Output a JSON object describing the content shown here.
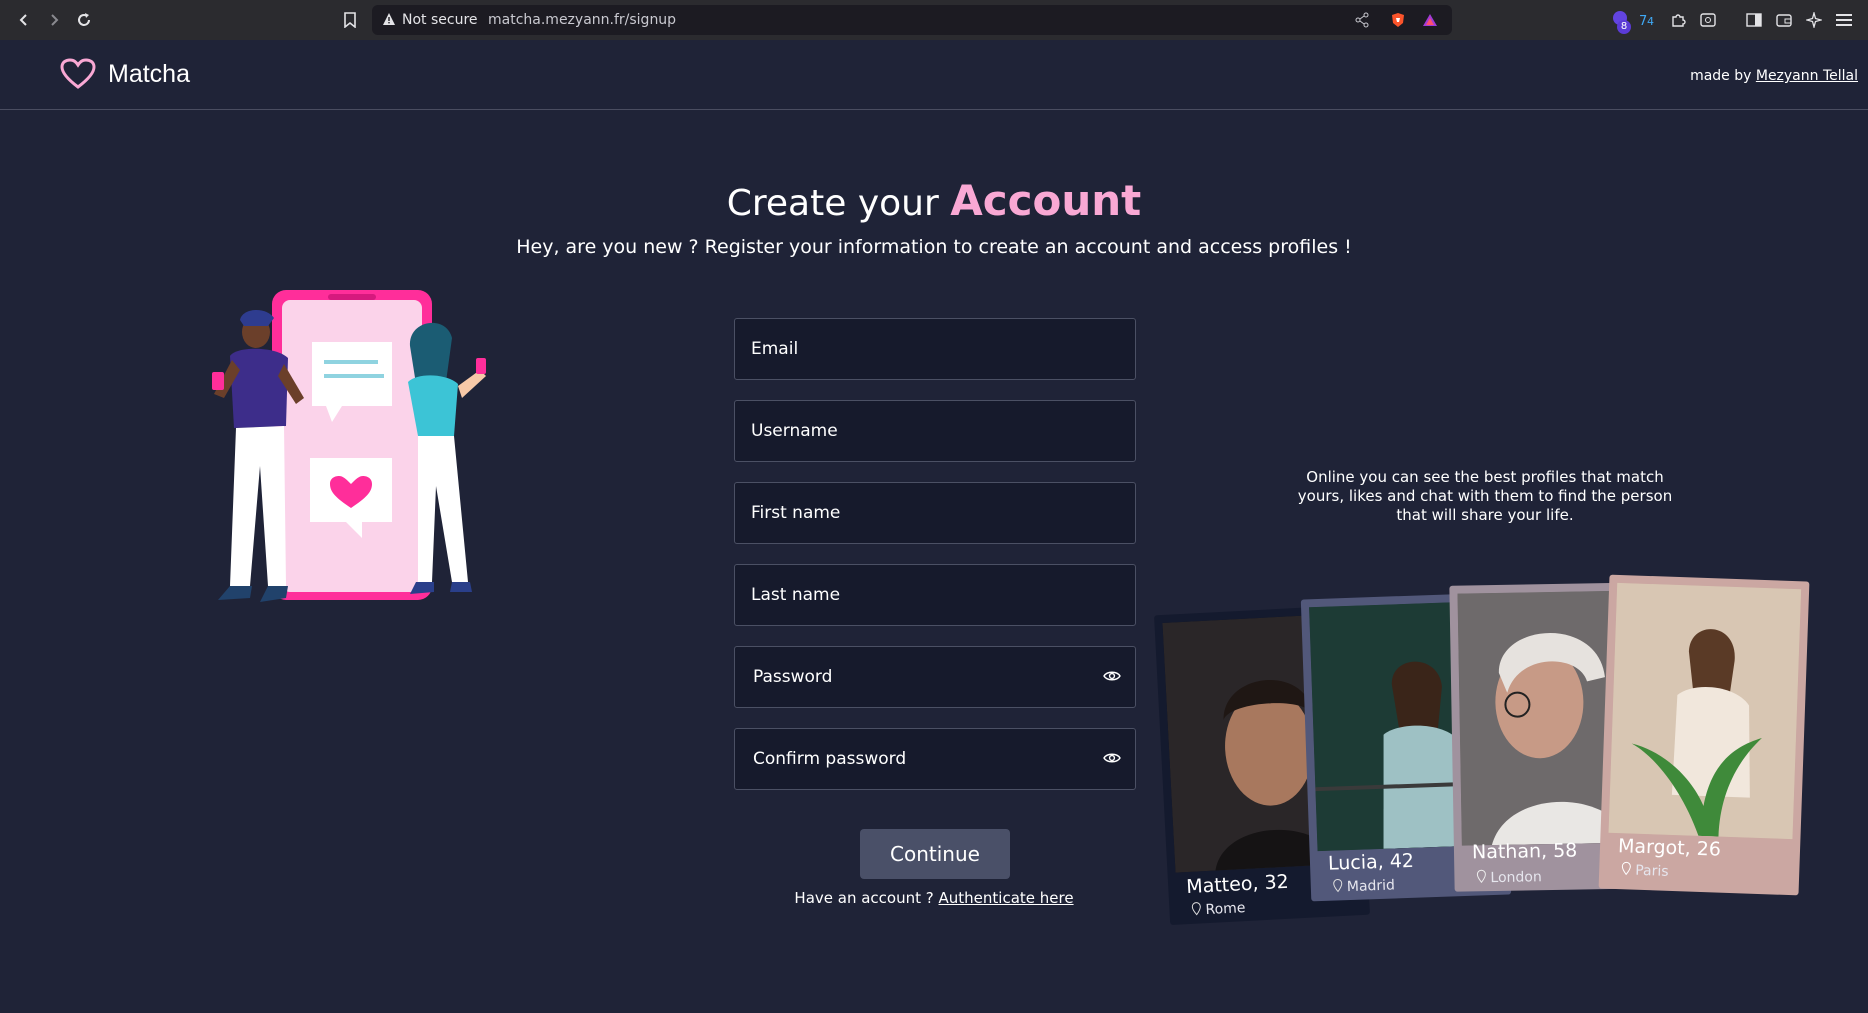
{
  "browser": {
    "security_label": "Not secure",
    "url": "matcha.mezyann.fr/signup",
    "extension_badge": "8"
  },
  "header": {
    "app_name": "Matcha",
    "made_by_prefix": "made by",
    "author": "Mezyann Tellal"
  },
  "hero": {
    "title_prefix": "Create your",
    "title_accent": "Account",
    "subtitle": "Hey, are you new ? Register your information to create an account and access profiles !"
  },
  "form": {
    "email_label": "Email",
    "username_label": "Username",
    "first_name_label": "First name",
    "last_name_label": "Last name",
    "password_label": "Password",
    "confirm_password_label": "Confirm password",
    "continue_label": "Continue",
    "have_account_text": "Have an account ?",
    "authenticate_link": "Authenticate here"
  },
  "promo": {
    "text": "Online you can see the best profiles that match yours, likes and chat with them to find the person that will share your life."
  },
  "profiles": [
    {
      "name": "Matteo, 32",
      "city": "Rome"
    },
    {
      "name": "Lucia, 42",
      "city": "Madrid"
    },
    {
      "name": "Nathan, 58",
      "city": "London"
    },
    {
      "name": "Margot, 26",
      "city": "Paris"
    }
  ],
  "colors": {
    "background": "#1f2337",
    "accent_pink": "#f9a8d4",
    "field_bg": "#161a2c",
    "button_bg": "#4a5068"
  }
}
